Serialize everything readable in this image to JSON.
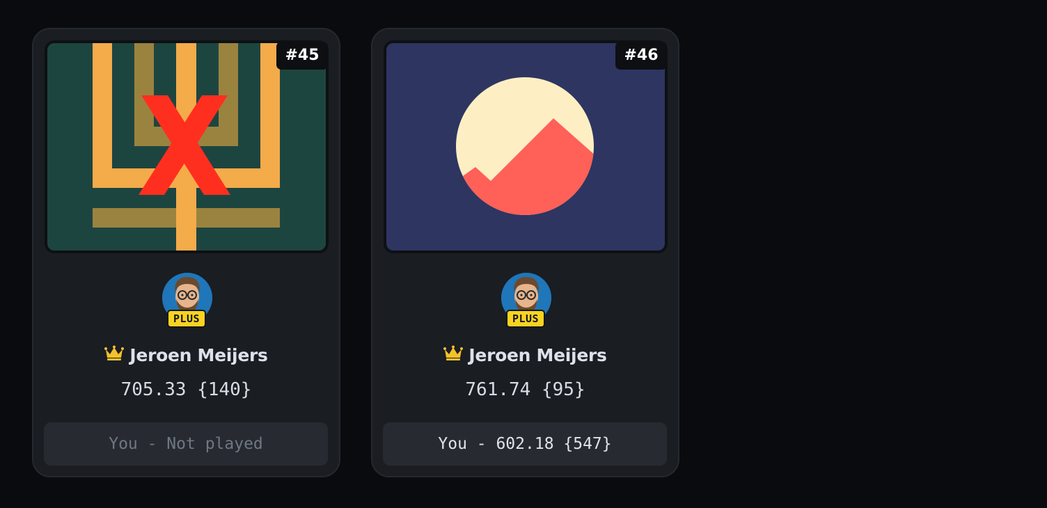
{
  "colors": {
    "page_bg": "#090b0f",
    "card_bg": "#1a1d22",
    "badge_plus": "#f8d321",
    "crown": "#f5c12c",
    "text_primary": "#dde1ea",
    "text_muted": "#6f7782"
  },
  "cards": [
    {
      "number": "#45",
      "image": "menorah-with-red-x",
      "author": {
        "name": "Jeroen Meijers",
        "badge": "PLUS",
        "crown_icon": "crown-icon"
      },
      "score": "705.33 {140}",
      "you": "You - Not played",
      "you_played": false
    },
    {
      "number": "#46",
      "image": "sun-mountain-circle",
      "author": {
        "name": "Jeroen Meijers",
        "badge": "PLUS",
        "crown_icon": "crown-icon"
      },
      "score": "761.74 {95}",
      "you": "You - 602.18 {547}",
      "you_played": true
    }
  ]
}
